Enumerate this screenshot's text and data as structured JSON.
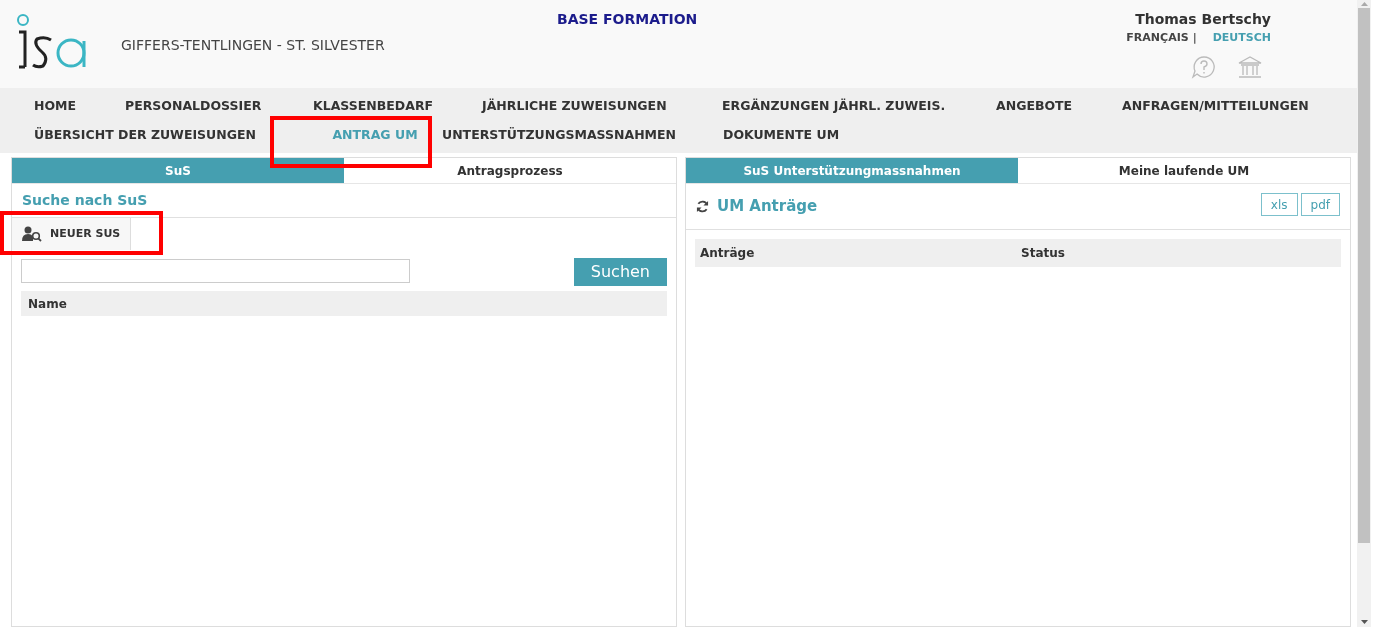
{
  "header": {
    "school": "GIFFERS-TENTLINGEN - ST. SILVESTER",
    "title": "BASE FORMATION",
    "user": "Thomas Bertschy",
    "languages": [
      {
        "label": "FRANÇAIS",
        "selected": false
      },
      {
        "label": "DEUTSCH",
        "selected": true
      }
    ],
    "separator": "|"
  },
  "nav": [
    [
      {
        "label": "HOME",
        "selected": false
      },
      {
        "label": "PERSONALDOSSIER",
        "selected": false
      },
      {
        "label": "KLASSENBEDARF",
        "selected": false
      },
      {
        "label": "JÄHRLICHE ZUWEISUNGEN",
        "selected": false
      },
      {
        "label": "ERGÄNZUNGEN JÄHRL. ZUWEIS.",
        "selected": false
      },
      {
        "label": "ANGEBOTE",
        "selected": false
      },
      {
        "label": "ANFRAGEN/MITTEILUNGEN",
        "selected": false
      }
    ],
    [
      {
        "label": "ÜBERSICHT DER ZUWEISUNGEN",
        "selected": false
      },
      {
        "label": "ANTRAG UM",
        "selected": true
      },
      {
        "label": "UNTERSTÜTZUNGSMASSNAHMEN",
        "selected": false
      },
      {
        "label": "DOKUMENTE UM",
        "selected": false
      }
    ]
  ],
  "left_panel": {
    "tabs": [
      {
        "label": "SuS",
        "selected": true
      },
      {
        "label": "Antragsprozess",
        "selected": false
      }
    ],
    "heading": "Suche nach SuS",
    "new_button": "NEUER SUS",
    "search_button": "Suchen",
    "columns": [
      "Name"
    ]
  },
  "right_panel": {
    "tabs": [
      {
        "label": "SuS Unterstützungmassnahmen",
        "selected": true
      },
      {
        "label": "Meine laufende UM",
        "selected": false
      }
    ],
    "heading": "UM Anträge",
    "exports": [
      "xls",
      "pdf"
    ],
    "columns": [
      "Anträge",
      "Status"
    ]
  }
}
